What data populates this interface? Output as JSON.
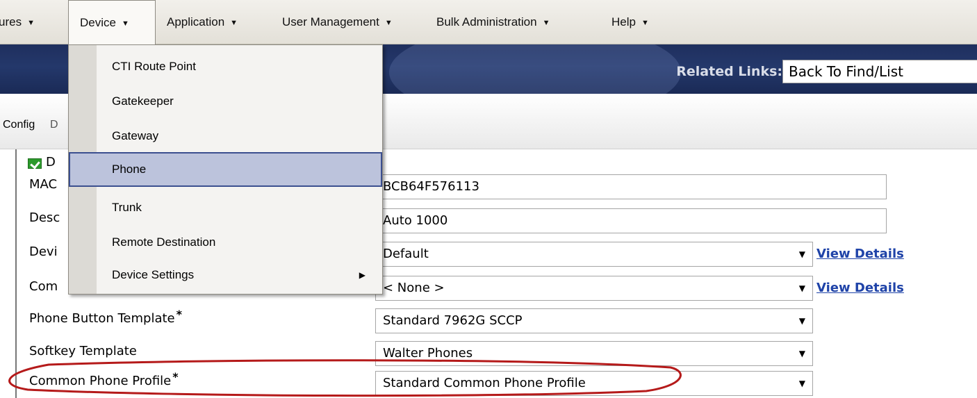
{
  "menubar": {
    "items": [
      {
        "label": "ures"
      },
      {
        "label": "Device"
      },
      {
        "label": "Application"
      },
      {
        "label": "User Management"
      },
      {
        "label": "Bulk Administration"
      },
      {
        "label": "Help"
      }
    ]
  },
  "header": {
    "related_links_label": "Related Links:",
    "related_links_value": "Back To Find/List"
  },
  "toolbar": {
    "config_label": "Config",
    "extra_label": "D"
  },
  "device_menu": {
    "items": [
      {
        "label": "CTI Route Point"
      },
      {
        "label": "Gatekeeper"
      },
      {
        "label": "Gateway"
      },
      {
        "label": "Phone"
      },
      {
        "label": "Trunk"
      },
      {
        "label": "Remote Destination"
      },
      {
        "label": "Device Settings"
      }
    ],
    "selected": "Phone"
  },
  "form": {
    "status_letter": "D",
    "fields": [
      {
        "label": "MAC",
        "value": "BCB64F576113"
      },
      {
        "label": "Desc",
        "value": "Auto 1000"
      },
      {
        "label": "Devi",
        "value": "Default",
        "link": "View Details"
      },
      {
        "label": "Com",
        "value": "< None >",
        "link": "View Details"
      },
      {
        "label": "Phone Button Template",
        "required": "*",
        "value": "Standard 7962G SCCP"
      },
      {
        "label": "Softkey Template",
        "value": "Walter Phones"
      },
      {
        "label": "Common Phone Profile",
        "required": "*",
        "value": "Standard Common Phone Profile"
      }
    ]
  },
  "colors": {
    "menu_bg": "#e3e0d8",
    "header_band": "#1f2f5e",
    "link": "#1f43a8",
    "selected_item": "#bcc3dc",
    "annotation": "#b51a1a"
  }
}
